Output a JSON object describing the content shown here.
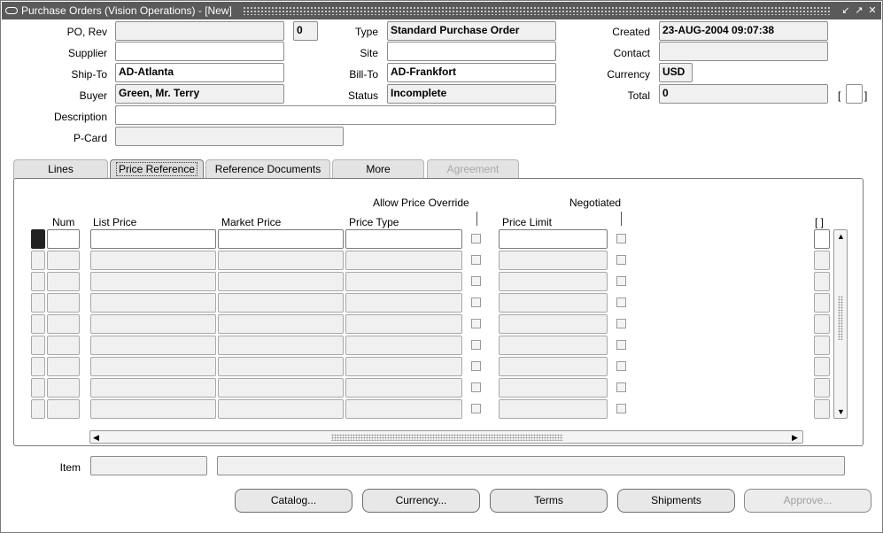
{
  "window": {
    "title": "Purchase Orders (Vision Operations) - [New]"
  },
  "header": {
    "po_rev_label": "PO, Rev",
    "po_value": "",
    "rev_value": "0",
    "type_label": "Type",
    "type_value": "Standard Purchase Order",
    "created_label": "Created",
    "created_value": "23-AUG-2004 09:07:38",
    "supplier_label": "Supplier",
    "supplier_value": "",
    "site_label": "Site",
    "site_value": "",
    "contact_label": "Contact",
    "contact_value": "",
    "ship_to_label": "Ship-To",
    "ship_to_value": "AD-Atlanta",
    "bill_to_label": "Bill-To",
    "bill_to_value": "AD-Frankfort",
    "currency_label": "Currency",
    "currency_value": "USD",
    "buyer_label": "Buyer",
    "buyer_value": "Green, Mr. Terry",
    "status_label": "Status",
    "status_value": "Incomplete",
    "total_label": "Total",
    "total_value": "0",
    "description_label": "Description",
    "description_value": "",
    "pcard_label": "P-Card",
    "pcard_value": "",
    "dff_open": "[",
    "dff_close": "]"
  },
  "tabs": [
    {
      "label": "Lines",
      "active": false,
      "enabled": true
    },
    {
      "label": "Price Reference",
      "active": true,
      "enabled": true
    },
    {
      "label": "Reference Documents",
      "active": false,
      "enabled": true
    },
    {
      "label": "More",
      "active": false,
      "enabled": true
    },
    {
      "label": "Agreement",
      "active": false,
      "enabled": false
    }
  ],
  "grid": {
    "group_allow_override": "Allow Price Override",
    "group_negotiated": "Negotiated",
    "col_num": "Num",
    "col_list_price": "List Price",
    "col_market_price": "Market Price",
    "col_price_type": "Price Type",
    "col_price_limit": "Price Limit",
    "col_dff": "[ ]",
    "row_count": 9
  },
  "footer": {
    "item_label": "Item",
    "item_value": "",
    "item_desc": ""
  },
  "buttons": {
    "catalog": "Catalog...",
    "currency": "Currency...",
    "terms": "Terms",
    "shipments": "Shipments",
    "approve": "Approve..."
  }
}
